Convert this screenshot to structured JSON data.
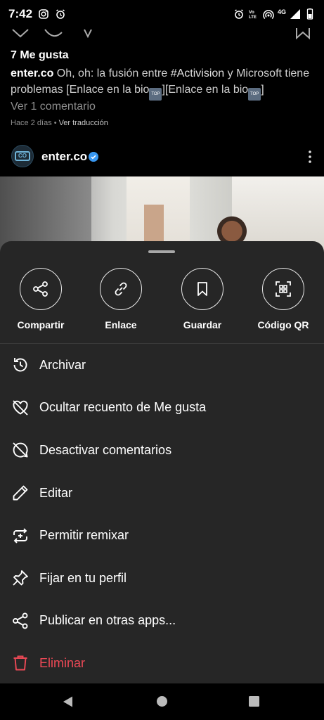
{
  "status_bar": {
    "time": "7:42",
    "network": "4G"
  },
  "post_above": {
    "likes": "7 Me gusta",
    "caption_user": "enter.co",
    "caption_text_1": " Oh, oh: la fusión entre ",
    "hashtag": "#Activision",
    "caption_text_2": " y Microsoft tiene problemas [Enlace en la bio",
    "caption_text_3": "][Enlace en la bio",
    "caption_text_4": "]",
    "view_comments": "Ver 1 comentario",
    "time_ago": "Hace 2 días",
    "meta_separator": "•",
    "see_translation": "Ver traducción"
  },
  "post_header": {
    "username": "enter.co",
    "avatar_text": "CO"
  },
  "sheet": {
    "quick_actions": [
      {
        "label": "Compartir",
        "icon": "share-icon"
      },
      {
        "label": "Enlace",
        "icon": "link-icon"
      },
      {
        "label": "Guardar",
        "icon": "bookmark-icon"
      },
      {
        "label": "Código QR",
        "icon": "qr-code-icon"
      }
    ],
    "menu": [
      {
        "label": "Archivar",
        "icon": "archive-history-icon"
      },
      {
        "label": "Ocultar recuento de Me gusta",
        "icon": "heart-off-icon"
      },
      {
        "label": "Desactivar comentarios",
        "icon": "comment-off-icon"
      },
      {
        "label": "Editar",
        "icon": "pencil-icon"
      },
      {
        "label": "Permitir remixar",
        "icon": "remix-icon"
      },
      {
        "label": "Fijar en tu perfil",
        "icon": "pin-icon"
      },
      {
        "label": "Publicar en otras apps...",
        "icon": "share-nodes-icon"
      },
      {
        "label": "Eliminar",
        "icon": "trash-icon"
      }
    ]
  },
  "colors": {
    "sheet_bg": "#262626",
    "danger": "#ed4956",
    "muted": "#8e8e8e",
    "verified": "#3897f0"
  }
}
